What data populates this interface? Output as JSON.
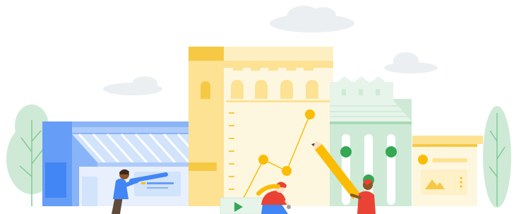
{
  "illustration": {
    "theme": "town-street-analytics",
    "colors": {
      "cloud": "#eceff1",
      "blue_building": "#8ab4f8",
      "blue_dark": "#669df6",
      "blue_light": "#d2e3fc",
      "blue_pale": "#e8f0fe",
      "yellow_tower": "#fde293",
      "yellow_dark": "#f6c945",
      "cream": "#fef7e0",
      "green_building": "#ceead6",
      "green_light": "#e6f4ea",
      "green_dot": "#34a853",
      "chart_yellow": "#fbbc04",
      "tree_green": "#ceead6",
      "skin_dark": "#8d5524",
      "red": "#ea4335",
      "navy": "#174ea6"
    },
    "line_chart_points": [
      {
        "x": 1,
        "y": 2
      },
      {
        "x": 2,
        "y": 1.5
      },
      {
        "x": 3,
        "y": 4
      }
    ],
    "slider_levels": [
      0.75,
      0.35,
      0.75
    ]
  }
}
